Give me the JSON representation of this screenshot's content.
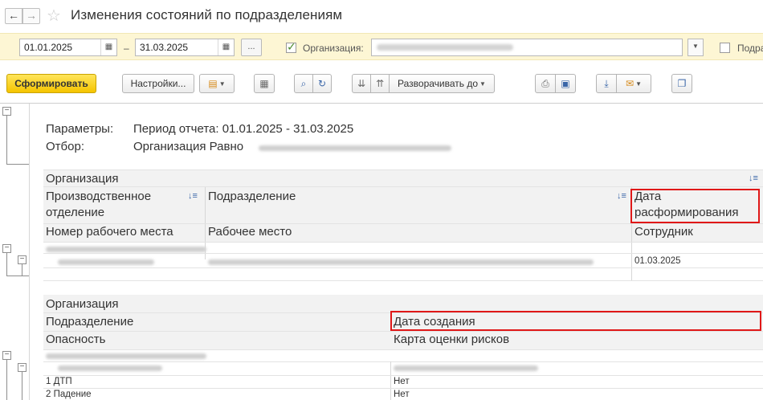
{
  "title": "Изменения состояний по подразделениям",
  "icons": {
    "back": "arrow-left",
    "forward": "arrow-right",
    "favorite": "star",
    "calendar": "calendar",
    "print": "printer",
    "preview": "print-preview",
    "save": "download",
    "mail": "envelope",
    "copy": "copy"
  },
  "params": {
    "date_from": "01.01.2025",
    "date_to": "31.03.2025",
    "dots": "...",
    "org_label": "Организация:",
    "subdiv_label": "Подра"
  },
  "toolbar": {
    "generate": "Сформировать",
    "settings": "Настройки...",
    "expand": "Разворачивать до"
  },
  "report": {
    "params_label": "Параметры:",
    "params_value": "Период отчета: 01.01.2025 - 31.03.2025",
    "filter_label": "Отбор:",
    "filter_value": "Организация Равно",
    "table1": {
      "h_org": "Организация",
      "h_prod_1": "Производственное",
      "h_prod_2": "отделение",
      "h_subdiv": "Подразделение",
      "h_date_1": "Дата",
      "h_date_2": "расформирования",
      "h_workplace_num": "Номер рабочего места",
      "h_workplace": "Рабочее место",
      "h_employee": "Сотрудник",
      "row_date": "01.03.2025"
    },
    "table2": {
      "h_org": "Организация",
      "h_subdiv": "Подразделение",
      "h_created": "Дата создания",
      "h_hazard": "Опасность",
      "h_riskmap": "Карта оценки рисков",
      "rows": [
        {
          "hazard": "1 ДТП",
          "value": "Нет"
        },
        {
          "hazard": "2 Падение",
          "value": "Нет"
        }
      ]
    }
  },
  "colors": {
    "accent_yellow": "#f5c400",
    "params_bg": "#fdf6d4",
    "highlight_red": "#e01818",
    "header_bg": "#f2f2f2"
  }
}
